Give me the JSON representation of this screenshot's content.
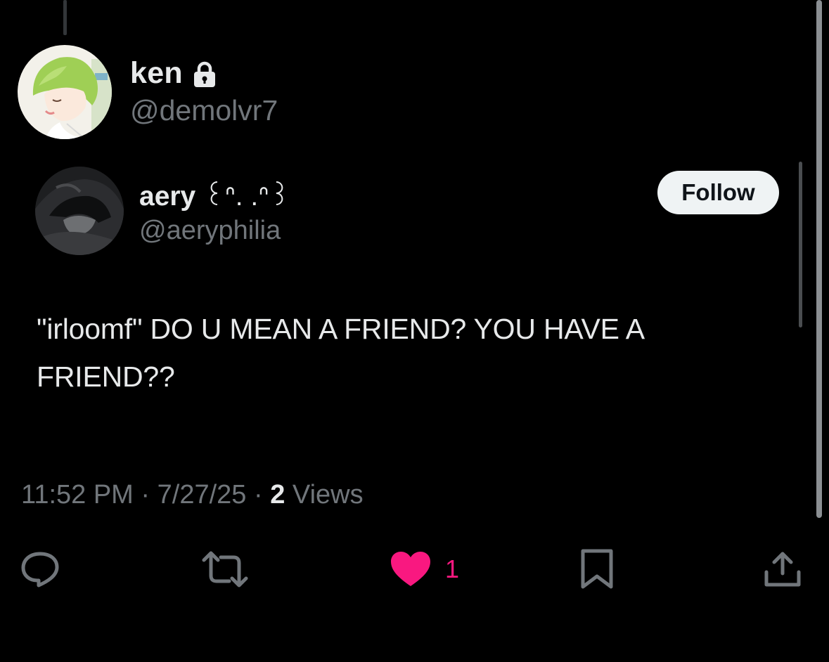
{
  "quoting_user": {
    "name": "ken",
    "handle": "@demolvr7",
    "protected_icon": "lock-icon"
  },
  "quoted_post": {
    "author": {
      "name": "aery",
      "name_decoration": "꒰ᐢ. .ᐢ꒱",
      "handle": "@aeryphilia"
    },
    "follow_label": "Follow",
    "text": "\"irloomf\" DO U MEAN A FRIEND? YOU HAVE A FRIEND??"
  },
  "meta": {
    "time": "11:52 PM",
    "separator": "·",
    "date": "7/27/25",
    "views_count": "2",
    "views_label": "Views"
  },
  "actions": {
    "reply_icon": "reply-icon",
    "repost_icon": "repost-icon",
    "like_icon": "heart-icon",
    "like_count": "1",
    "bookmark_icon": "bookmark-icon",
    "share_icon": "share-icon"
  },
  "colors": {
    "background": "#000000",
    "text_primary": "#e7e9ea",
    "text_secondary": "#71767b",
    "like_active": "#f91880",
    "follow_button_bg": "#eff3f4"
  }
}
